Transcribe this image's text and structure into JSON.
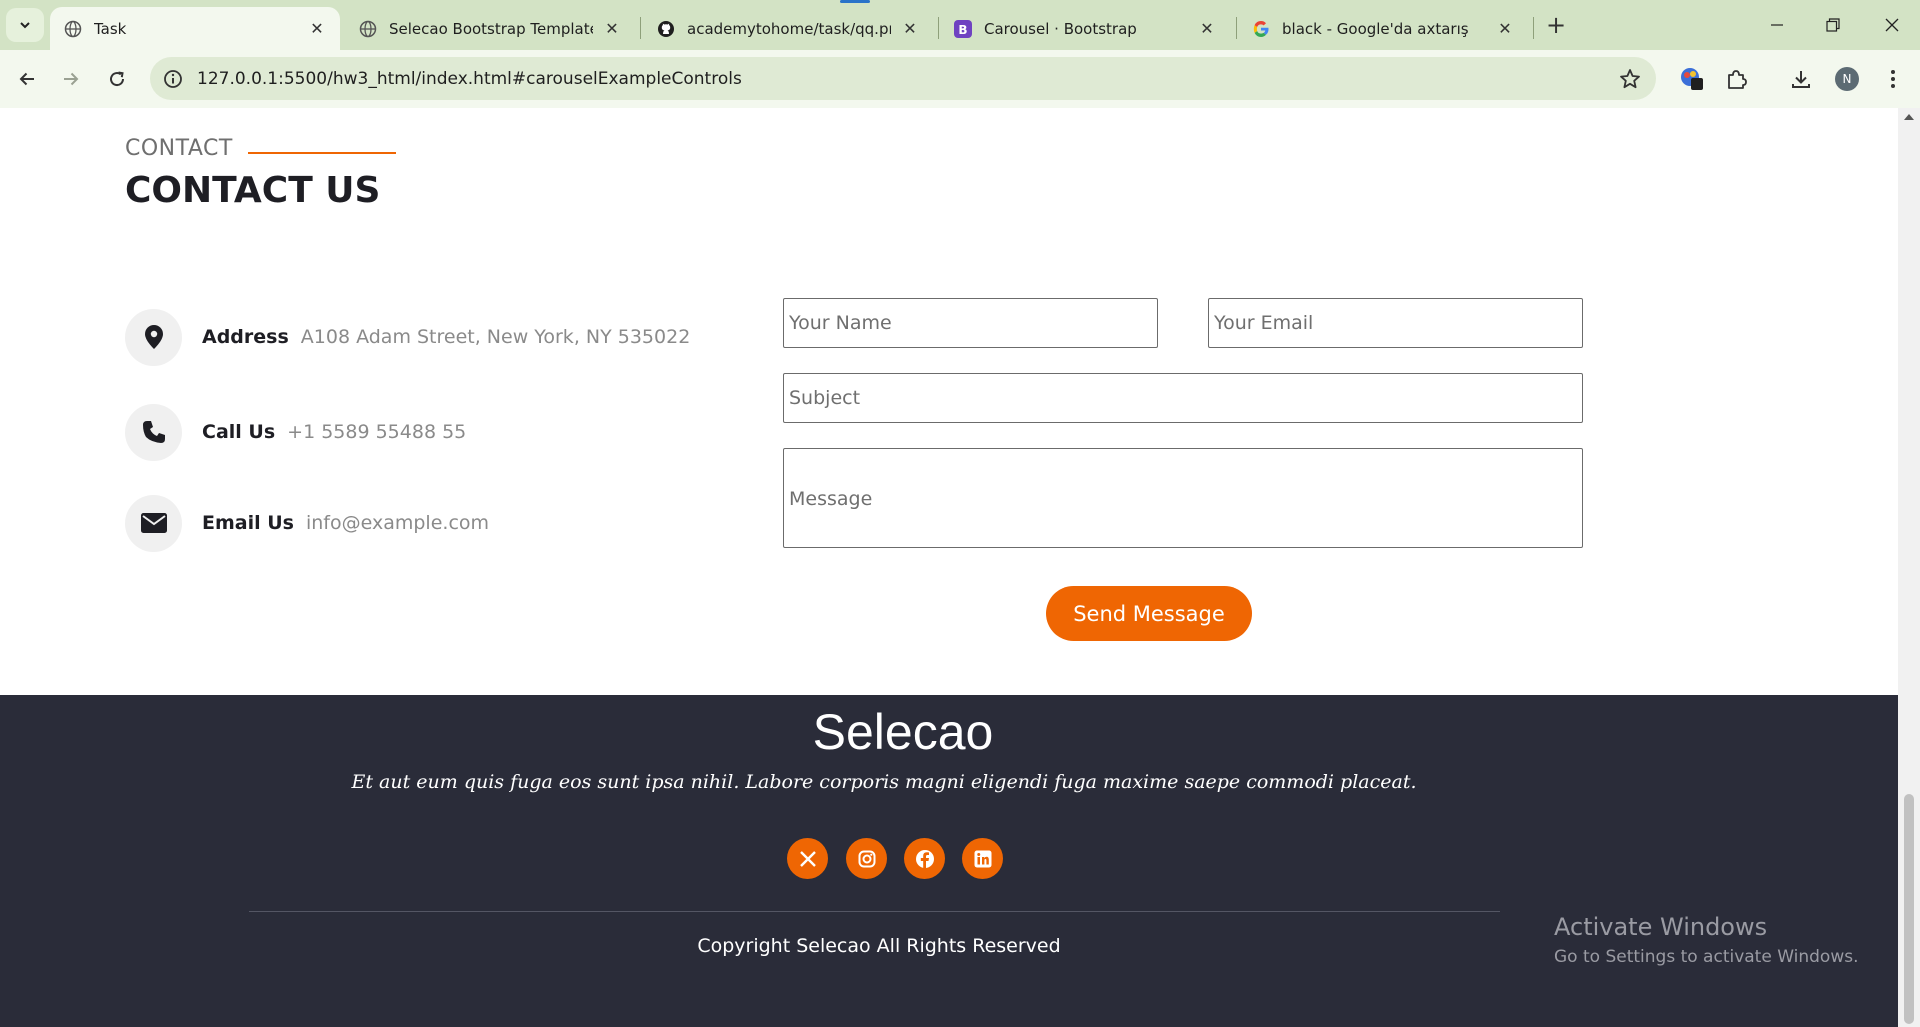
{
  "browser": {
    "tabs": [
      {
        "title": "Task",
        "active": true
      },
      {
        "title": "Selecao Bootstrap Template De",
        "active": false
      },
      {
        "title": "academytohome/task/qq.png a",
        "active": false
      },
      {
        "title": "Carousel · Bootstrap",
        "active": false
      },
      {
        "title": "black - Google'da axtarış",
        "active": false
      }
    ],
    "url": "127.0.0.1:5500/hw3_html/index.html#carouselExampleControls",
    "profile_initial": "N"
  },
  "contact": {
    "kicker": "CONTACT",
    "title": "CONTACT US",
    "items": [
      {
        "label": "Address",
        "value": "A108 Adam Street, New York, NY 535022",
        "icon": "map-pin-icon"
      },
      {
        "label": "Call Us",
        "value": "+1 5589 55488 55",
        "icon": "phone-icon"
      },
      {
        "label": "Email Us",
        "value": "info@example.com",
        "icon": "envelope-icon"
      }
    ],
    "form": {
      "name_placeholder": "Your Name",
      "email_placeholder": "Your Email",
      "subject_placeholder": "Subject",
      "message_placeholder": "Message",
      "submit_label": "Send Message"
    }
  },
  "footer": {
    "brand": "Selecao",
    "tagline": "Et aut eum quis fuga eos sunt ipsa nihil. Labore corporis magni eligendi fuga maxime saepe commodi placeat.",
    "social": [
      "x-icon",
      "instagram-icon",
      "facebook-icon",
      "linkedin-icon"
    ],
    "copyright": "Copyright Selecao All Rights Reserved"
  },
  "watermark": {
    "line1": "Activate Windows",
    "line2": "Go to Settings to activate Windows."
  },
  "colors": {
    "accent": "#ef6603",
    "footer_bg": "#2a2c39",
    "tabbar_bg": "#d3e3c5"
  }
}
